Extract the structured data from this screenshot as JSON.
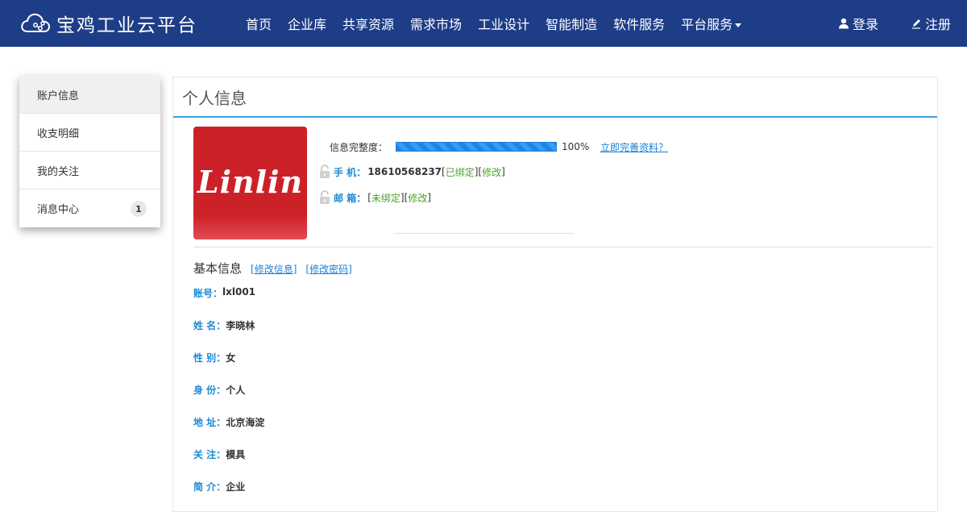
{
  "brand": {
    "name": "宝鸡工业云平台",
    "logo_icon": "cloud-logo-icon"
  },
  "nav": {
    "items": [
      "首页",
      "企业库",
      "共享资源",
      "需求市场",
      "工业设计",
      "智能制造",
      "软件服务",
      "平台服务"
    ]
  },
  "auth": {
    "login": "登录",
    "register": "注册"
  },
  "sidebar": {
    "items": [
      {
        "label": "账户信息"
      },
      {
        "label": "收支明细"
      },
      {
        "label": "我的关注"
      },
      {
        "label": "消息中心",
        "badge": "1"
      }
    ]
  },
  "panel": {
    "title": "个人信息"
  },
  "profile": {
    "avatar_text": "Linlin",
    "completeness_label": "信息完整度：",
    "completeness_value": "100%",
    "completeness_fraction": 1.0,
    "complete_link": "立即完善资料？",
    "phone_label": "手 机：",
    "phone_value": "18610568237",
    "phone_status": "已绑定",
    "phone_edit": "修改",
    "email_label": "邮 箱：",
    "email_status": "未绑定",
    "email_edit": "修改"
  },
  "basic": {
    "title": "基本信息",
    "edit_info": "[修改信息]",
    "edit_password": "[修改密码]",
    "fields": [
      {
        "label": "账号：",
        "value": "lxl001"
      },
      {
        "label": "姓 名：",
        "value": "李晓林"
      },
      {
        "label": "性 别：",
        "value": "女"
      },
      {
        "label": "身 份：",
        "value": "个人"
      },
      {
        "label": "地 址：",
        "value": "北京海淀"
      },
      {
        "label": "关 注：",
        "value": "模具"
      },
      {
        "label": "简 介：",
        "value": "企业"
      }
    ]
  },
  "colors": {
    "header_bg": "#1e3d87",
    "accent": "#3aa3dc",
    "link": "#1a7fd4",
    "bound_green": "#4aa52e"
  }
}
